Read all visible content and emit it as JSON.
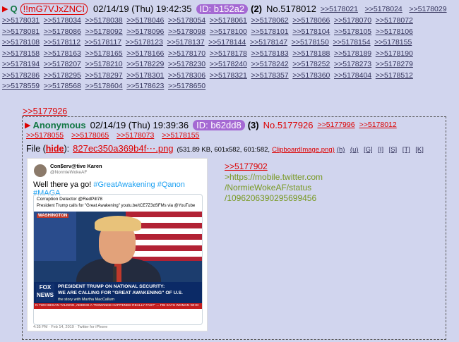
{
  "post": {
    "arrow": "▶",
    "q": "Q",
    "tripcode": "!!mG7VJxZNCI",
    "date": "02/14/19 (Thu) 19:42:35",
    "id_label": "ID: b152a2",
    "count": "(2)",
    "number": "No.5178012",
    "reply_links": [
      ">>5178021",
      ">>5178024",
      ">>5178029"
    ],
    "reply_rows": [
      [
        ">>5178031",
        ">>5178034",
        ">>5178038",
        ">>5178046",
        ">>5178054",
        ">>5178061",
        ">>5178062",
        ">>5178066",
        ">>5178070",
        ">>5178072"
      ],
      [
        ">>5178081",
        ">>5178086",
        ">>5178092",
        ">>5178096",
        ">>5178098",
        ">>5178100",
        ">>5178101",
        ">>5178104",
        ">>5178105",
        ">>5178106"
      ],
      [
        ">>5178108",
        ">>5178112",
        ">>5178117",
        ">>5178123",
        ">>5178137",
        ">>5178144",
        ">>5178147",
        ">>5178150",
        ">>5178154",
        ">>5178155"
      ],
      [
        ">>5178158",
        ">>5178163",
        ">>5178165",
        ">>5178166",
        ">>5178170",
        ">>5178178",
        ">>5178183",
        ">>5178188",
        ">>5178189",
        ">>5178190"
      ],
      [
        ">>5178194",
        ">>5178207",
        ">>5178210",
        ">>5178229",
        ">>5178230",
        ">>5178240",
        ">>5178242",
        ">>5178252",
        ">>5178273",
        ">>5178279"
      ],
      [
        ">>5178286",
        ">>5178295",
        ">>5178297",
        ">>5178301",
        ">>5178306",
        ">>5178321",
        ">>5178357",
        ">>5178360",
        ">>5178404",
        ">>5178512"
      ],
      [
        ">>5178559",
        ">>5178568",
        ">>5178604",
        ">>5178623",
        ">>5178650"
      ]
    ],
    "quote_link": ">>5177926"
  },
  "quoted": {
    "arrow": "▶",
    "name": "Anonymous",
    "date": "02/14/19 (Thu) 19:39:36",
    "id_label": "ID: b62dd8",
    "count": "(3)",
    "number": "No.5177926",
    "header_links": [
      ">>5177996",
      ">>5178012"
    ],
    "row2_links": [
      ">>5178055",
      ">>5178065",
      ">>5178073",
      ">>5178155"
    ],
    "file": {
      "label": "File (",
      "hide": "hide",
      "close": "):",
      "name": "827ec350a369b4f⋯.png",
      "meta": "(531.89 KB, 601x582, 601:582,",
      "orig": "ClipboardImage.png)",
      "ops": [
        "(h)",
        "(u)",
        "[G]",
        "[I]",
        "[S]",
        "[T]",
        "[K]"
      ]
    },
    "tweet": {
      "author": "Con$erv@tive Karen",
      "handle": "@NormieWokeAF",
      "text_prefix": "Well there ya go! ",
      "hashtags": "#GreatAwakening #Qanon #MAGA",
      "card_line1": "Corruption Detector @RedPill78",
      "card_line2": "President Trump calls for \"Great Awakening\" youtu.be/tCE7Z3dSFMs via @YouTube",
      "washington": "WASHINGTON",
      "fox": "FOX NEWS",
      "lower1": "PRESIDENT TRUMP ON NATIONAL SECURITY:",
      "lower2": "WE ARE CALLING FOR \"GREAT AWAKENING\" OF U.S.",
      "lower3": "the story with Martha MacCallum",
      "ticker": "N TWO BEGAN TALKING, ADDING A \"ROMANCE HAPPENED REALLY FAST\" ... FBI SAYS WOMAN WHO",
      "time": "4:35 PM · Feb 14, 2019 · Twitter for iPhone"
    },
    "body": {
      "quote": ">>5177902",
      "line1": ">https://mobile.twitter.com",
      "line2": "/NormieWokeAF/status",
      "line3": "/1096206390295699456"
    }
  },
  "colors": {
    "background": "#d1d5ee",
    "link": "#34345c",
    "red": "#dd0000",
    "green": "#117743",
    "greentext": "#789922",
    "id_pill": "#a569d3"
  }
}
